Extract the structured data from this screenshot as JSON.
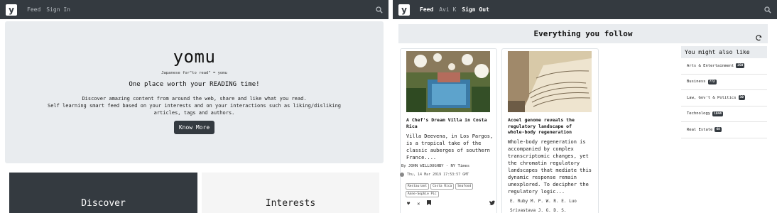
{
  "left": {
    "nav": {
      "logo": "y",
      "feed": "Feed",
      "sign_in": "Sign In"
    },
    "hero": {
      "brand": "yomu",
      "brand_sub": "Japanese for\"to read\" = yomu",
      "tagline": "One place worth your READING time!",
      "desc_1": "Discover amazing content from around the web, share and like what you read.",
      "desc_2": "Self learning smart feed based on your interests and on your interactions such as liking/disliking",
      "desc_3": "articles, tags and authors.",
      "button": "Know More"
    },
    "cards": {
      "discover": "Discover",
      "interests": "Interests"
    }
  },
  "right": {
    "nav": {
      "logo": "y",
      "feed": "Feed",
      "user": "Avi K",
      "sign_out": "Sign Out"
    },
    "follow_title": "Everything you follow",
    "articles": [
      {
        "title_1": "A Chef's Dream Villa in Costa",
        "title_2": "Rica",
        "text": [
          "Villa Deevena, in Los Pargos,",
          "is a tropical take of the",
          "classic auberges of southern",
          "France...."
        ],
        "byline": "By JOHN WILLOUGHBY - NY Times",
        "date": "Thu, 14 Mar 2019 17:53:57 GMT",
        "tags": [
          "Restaurant",
          "Costa Rica",
          "Seafood",
          "Anne-Sophie Pic"
        ]
      },
      {
        "title_1": "Acoel genome reveals the",
        "title_2": "regulatory landscape of",
        "title_3": "whole-body regeneration",
        "text": [
          "Whole-body regeneration is",
          "accompanied by complex",
          "transcriptomic changes, yet",
          "the chromatin regulatory",
          "landscapes that mediate this",
          "dynamic response remain",
          "unexplored. To decipher the",
          "regulatory logic..."
        ],
        "authors_1": "E.  Ruby  M.  P. W.  R. E.  Luo",
        "authors_2": "Srivastava  J. G.  D. S."
      }
    ],
    "sidebar": {
      "heading": "You might also like",
      "items": [
        {
          "label": "Arts & Entertainment",
          "count": "250"
        },
        {
          "label": "Business",
          "count": "772"
        },
        {
          "label": "Law, Gov't & Politics",
          "count": "30"
        },
        {
          "label": "Technology",
          "count": "1844"
        },
        {
          "label": "Real Estate",
          "count": "68"
        }
      ]
    },
    "icons": {
      "like": "heart-icon",
      "dislike": "close-icon",
      "save": "bookmark-icon",
      "share": "twitter-icon"
    }
  },
  "colors": {
    "navbar": "#343a40",
    "jumbotron": "#e9ecef",
    "badge": "#343a40"
  }
}
